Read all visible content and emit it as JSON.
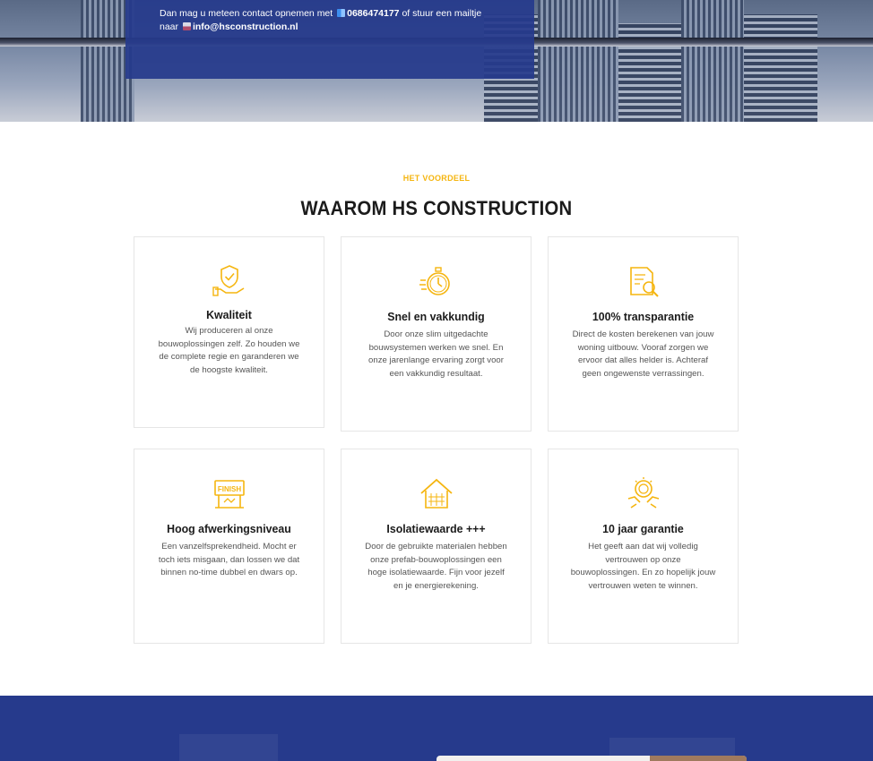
{
  "hero": {
    "contact_prefix": "Dan mag u meteen contact opnemen met",
    "phone": "0686474177",
    "contact_middle": "of stuur een mailtje",
    "contact_naar": "naar",
    "email": "info@hsconstruction.nl"
  },
  "section": {
    "eyebrow": "HET VOORDEEL",
    "title": "WAAROM HS CONSTRUCTION"
  },
  "cards": [
    {
      "icon": "quality-shield-hand-icon",
      "title": "Kwaliteit",
      "text": "Wij produceren al onze bouwoplossingen zelf. Zo houden we de complete regie en garanderen we de hoogste kwaliteit."
    },
    {
      "icon": "stopwatch-icon",
      "title": "Snel en vakkundig",
      "text": "Door onze slim uitgedachte bouwsystemen werken we snel. En onze jarenlange ervaring zorgt voor een vakkundig resultaat."
    },
    {
      "icon": "document-search-icon",
      "title": "100% transparantie",
      "text": "Direct de kosten berekenen van jouw woning uitbouw. Vooraf zorgen we ervoor dat alles helder is. Achteraf geen ongewenste verrassingen."
    },
    {
      "icon": "finish-sign-icon",
      "title": "Hoog afwerkingsniveau",
      "text": "Een vanzelfsprekendheid. Mocht er toch iets misgaan, dan lossen we dat binnen no-time dubbel en dwars op."
    },
    {
      "icon": "house-insulation-icon",
      "title": "Isolatiewaarde +++",
      "text": "Door de gebruikte materialen hebben onze prefab-bouwoplossingen een hoge isolatiewaarde. Fijn voor jezelf en je energierekening."
    },
    {
      "icon": "guarantee-badge-hands-icon",
      "title": "10 jaar garantie",
      "text": "Het geeft aan dat wij volledig vertrouwen op onze bouwoplossingen. En zo hopelijk jouw vertrouwen weten te winnen."
    }
  ],
  "colors": {
    "accent": "#f5b50f",
    "brand_blue": "#263a8c"
  }
}
